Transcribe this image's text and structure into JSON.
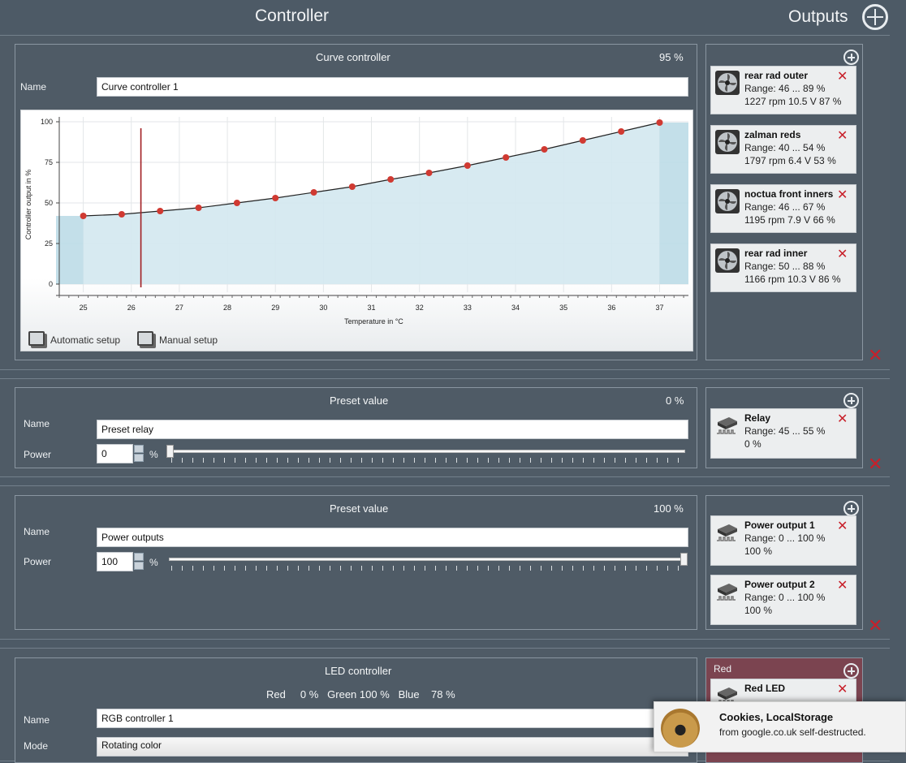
{
  "header": {
    "controller_title": "Controller",
    "outputs_title": "Outputs"
  },
  "curve": {
    "title": "Curve controller",
    "percent": "95 %",
    "name_label": "Name",
    "name_value": "Curve controller 1",
    "auto_setup": "Automatic setup",
    "manual_setup": "Manual setup",
    "outputs": [
      {
        "name": "rear rad outer",
        "range": "Range:  46 ... 89  %",
        "status": "1227 rpm  10.5 V  87 %"
      },
      {
        "name": "zalman reds",
        "range": "Range:  40 ... 54  %",
        "status": "1797 rpm  6.4 V  53 %"
      },
      {
        "name": "noctua front inners",
        "range": "Range:  46 ... 67  %",
        "status": "1195 rpm  7.9 V  66 %"
      },
      {
        "name": "rear rad inner",
        "range": "Range:  50 ... 88  %",
        "status": "1166 rpm  10.3 V  86 %"
      }
    ]
  },
  "chart_data": {
    "type": "line",
    "xlabel": "Temperature in °C",
    "ylabel": "Controller output in %",
    "xlim": [
      24.5,
      37.6
    ],
    "ylim": [
      -5,
      103
    ],
    "x_ticks": [
      25,
      26,
      27,
      28,
      29,
      30,
      31,
      32,
      33,
      34,
      35,
      36,
      37
    ],
    "y_ticks": [
      0,
      25,
      50,
      75,
      100
    ],
    "x": [
      25,
      25.8,
      26.6,
      27.4,
      28.2,
      29,
      29.8,
      30.6,
      31.4,
      32.2,
      33,
      33.8,
      34.6,
      35.4,
      36.2,
      37
    ],
    "y": [
      42,
      43,
      45,
      47,
      50,
      53,
      56.5,
      60,
      64.5,
      68.5,
      73,
      78,
      83,
      88.5,
      94,
      99.5
    ],
    "current_temperature": 26.2,
    "grid": true
  },
  "preset1": {
    "title": "Preset value",
    "percent": "0 %",
    "name_label": "Name",
    "name_value": "Preset relay",
    "power_label": "Power",
    "power_value": "0",
    "unit": "%",
    "level": 0,
    "outputs": [
      {
        "name": "Relay",
        "range": "Range:  45 ... 55  %",
        "status": "0 %"
      }
    ]
  },
  "preset2": {
    "title": "Preset value",
    "percent": "100 %",
    "name_label": "Name",
    "name_value": "Power outputs",
    "power_label": "Power",
    "power_value": "100",
    "unit": "%",
    "level": 100,
    "outputs": [
      {
        "name": "Power output 1",
        "range": "Range:  0 ... 100  %",
        "status": "100 %"
      },
      {
        "name": "Power output 2",
        "range": "Range:  0 ... 100  %",
        "status": "100 %"
      }
    ]
  },
  "led": {
    "title": "LED controller",
    "rgb": "Red     0 %   Green 100 %   Blue    78 %",
    "name_label": "Name",
    "name_value": "RGB controller 1",
    "mode_label": "Mode",
    "mode_value": "Rotating color",
    "channel": "Red",
    "outputs": [
      {
        "name": "Red LED"
      }
    ]
  },
  "toast": {
    "title": "Cookies, LocalStorage",
    "body": "from google.co.uk self-destructed."
  },
  "colors": {
    "accent_red": "#c8202a",
    "curve_point": "#d03a32",
    "fill": "#c3dfea",
    "red_channel": "#7b4450"
  }
}
